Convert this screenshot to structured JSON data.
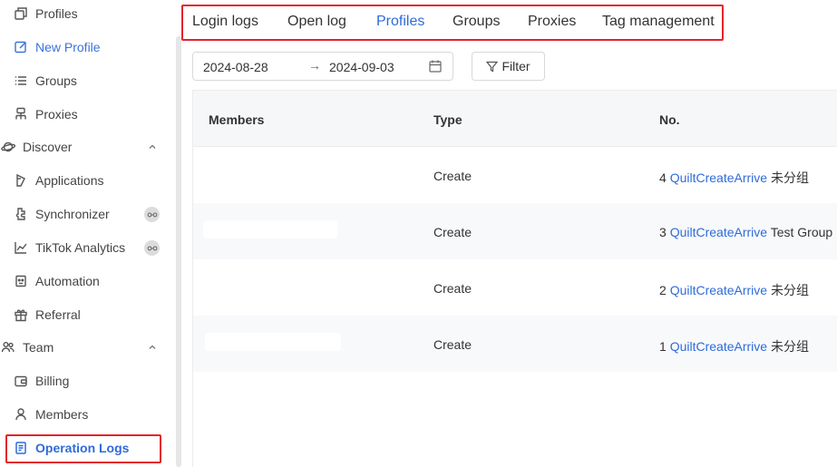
{
  "sidebar": {
    "items": [
      {
        "label": "Profiles",
        "icon": "profiles-icon"
      },
      {
        "label": "New Profile",
        "icon": "edit-icon"
      },
      {
        "label": "Groups",
        "icon": "list-icon"
      },
      {
        "label": "Proxies",
        "icon": "proxy-icon"
      },
      {
        "label": "Discover",
        "icon": "planet-icon"
      },
      {
        "label": "Applications",
        "icon": "puzzle-icon"
      },
      {
        "label": "Synchronizer",
        "icon": "sync-icon"
      },
      {
        "label": "TikTok Analytics",
        "icon": "chart-icon"
      },
      {
        "label": "Automation",
        "icon": "robot-icon"
      },
      {
        "label": "Referral",
        "icon": "gift-icon"
      },
      {
        "label": "Team",
        "icon": "team-icon"
      },
      {
        "label": "Billing",
        "icon": "wallet-icon"
      },
      {
        "label": "Members",
        "icon": "user-icon"
      },
      {
        "label": "Operation Logs",
        "icon": "document-icon"
      }
    ]
  },
  "tabs": [
    "Login logs",
    "Open log",
    "Profiles",
    "Groups",
    "Proxies",
    "Tag management"
  ],
  "active_tab": "Profiles",
  "date_range": {
    "start": "2024-08-28",
    "arrow": "→",
    "end": "2024-09-03"
  },
  "filter_label": "Filter",
  "table": {
    "headers": [
      "Members",
      "Type",
      "No."
    ],
    "rows": [
      {
        "type": "Create",
        "no": "4",
        "name": "QuiltCreateArrive",
        "group": "未分组"
      },
      {
        "type": "Create",
        "no": "3",
        "name": "QuiltCreateArrive",
        "group": "Test Group"
      },
      {
        "type": "Create",
        "no": "2",
        "name": "QuiltCreateArrive",
        "group": "未分组"
      },
      {
        "type": "Create",
        "no": "1",
        "name": "QuiltCreateArrive",
        "group": "未分组"
      }
    ]
  },
  "colors": {
    "accent": "#2f6bd9",
    "highlight": "#e4242a"
  }
}
